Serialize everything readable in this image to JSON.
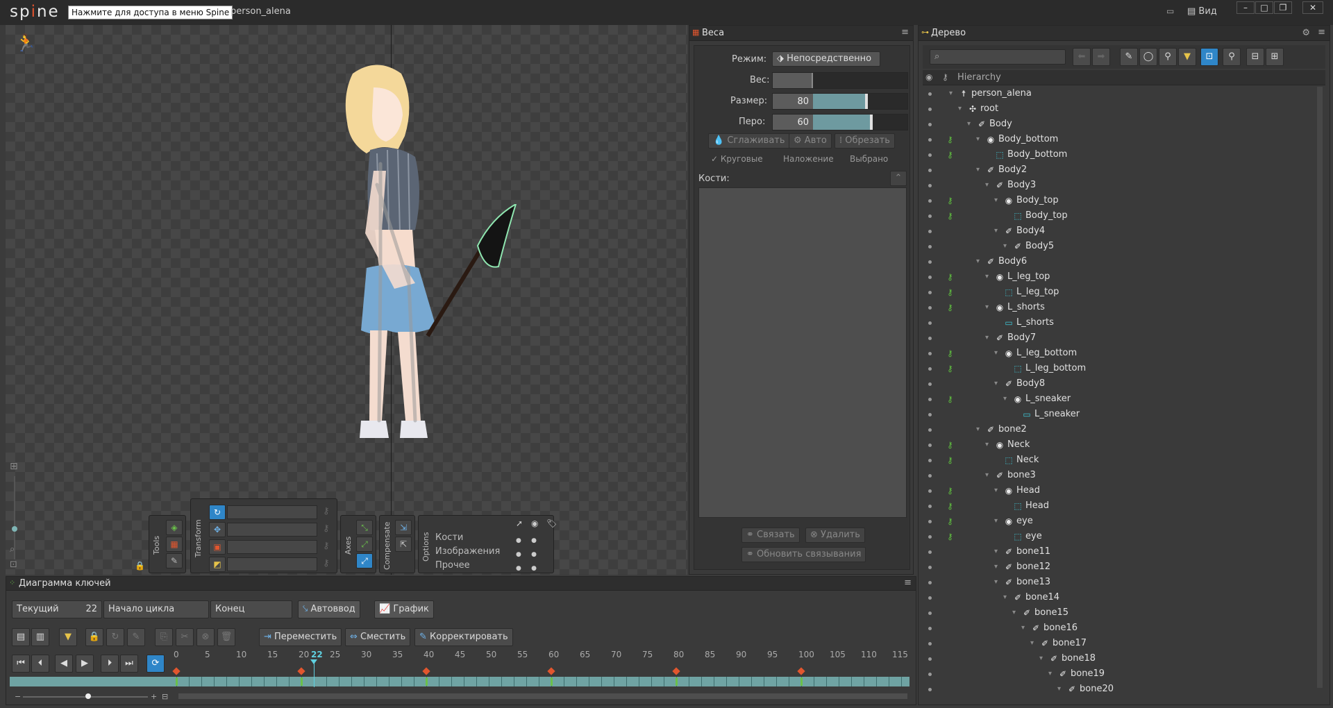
{
  "titlebar": {
    "logo": "spine",
    "tooltip": "Нажмите для доступа в меню Spine",
    "filename": "person_alena",
    "view_menu": "Вид"
  },
  "tools": {
    "tools_label": "Tools",
    "transform_label": "Transform",
    "axes_label": "Axes",
    "compensate_label": "Compensate",
    "options_label": "Options",
    "options_rows": [
      "Кости",
      "Изображения",
      "Прочее"
    ]
  },
  "weights": {
    "title": "Веса",
    "mode_label": "Режим:",
    "mode_value": "Непосредственно",
    "weight_label": "Вес:",
    "size_label": "Размер:",
    "size_value": "80",
    "size_fraction": 0.4,
    "feather_label": "Перо:",
    "feather_value": "60",
    "feather_fraction": 0.45,
    "smooth_btn": "Сглаживать",
    "auto_btn": "Авто",
    "prune_btn": "Обрезать",
    "circular_chk": "Круговые",
    "overlay_chk": "Наложение",
    "selected_chk": "Выбрано",
    "bones_label": "Кости:",
    "bind_btn": "Связать",
    "delete_btn": "Удалить",
    "update_btn": "Обновить связывания"
  },
  "tree": {
    "title": "Дерево",
    "hierarchy_label": "Hierarchy",
    "rows": [
      {
        "name": "person_alena",
        "depth": 0,
        "icon": "skeleton-icon",
        "key": false
      },
      {
        "name": "root",
        "depth": 1,
        "icon": "root-icon",
        "key": false
      },
      {
        "name": "Body",
        "depth": 2,
        "icon": "bone-icon",
        "key": false
      },
      {
        "name": "Body_bottom",
        "depth": 3,
        "icon": "slot-icon",
        "key": true
      },
      {
        "name": "Body_bottom",
        "depth": 4,
        "icon": "mesh-icon",
        "key": true
      },
      {
        "name": "Body2",
        "depth": 3,
        "icon": "bone-icon",
        "key": false
      },
      {
        "name": "Body3",
        "depth": 4,
        "icon": "bone-icon",
        "key": false
      },
      {
        "name": "Body_top",
        "depth": 5,
        "icon": "slot-icon",
        "key": true
      },
      {
        "name": "Body_top",
        "depth": 6,
        "icon": "mesh-icon",
        "key": true
      },
      {
        "name": "Body4",
        "depth": 5,
        "icon": "bone-icon",
        "key": false
      },
      {
        "name": "Body5",
        "depth": 6,
        "icon": "bone-icon",
        "key": false
      },
      {
        "name": "Body6",
        "depth": 3,
        "icon": "bone-icon",
        "key": false
      },
      {
        "name": "L_leg_top",
        "depth": 4,
        "icon": "slot-icon",
        "key": true
      },
      {
        "name": "L_leg_top",
        "depth": 5,
        "icon": "mesh-icon",
        "key": true
      },
      {
        "name": "L_shorts",
        "depth": 4,
        "icon": "slot-icon",
        "key": true
      },
      {
        "name": "L_shorts",
        "depth": 5,
        "icon": "region-icon",
        "key": false
      },
      {
        "name": "Body7",
        "depth": 4,
        "icon": "bone-icon",
        "key": false
      },
      {
        "name": "L_leg_bottom",
        "depth": 5,
        "icon": "slot-icon",
        "key": true
      },
      {
        "name": "L_leg_bottom",
        "depth": 6,
        "icon": "mesh-icon",
        "key": true
      },
      {
        "name": "Body8",
        "depth": 5,
        "icon": "bone-icon",
        "key": false
      },
      {
        "name": "L_sneaker",
        "depth": 6,
        "icon": "slot-icon",
        "key": true
      },
      {
        "name": "L_sneaker",
        "depth": 7,
        "icon": "region-icon",
        "key": false
      },
      {
        "name": "bone2",
        "depth": 3,
        "icon": "bone-icon",
        "key": false
      },
      {
        "name": "Neck",
        "depth": 4,
        "icon": "slot-icon",
        "key": true
      },
      {
        "name": "Neck",
        "depth": 5,
        "icon": "mesh-icon",
        "key": true
      },
      {
        "name": "bone3",
        "depth": 4,
        "icon": "bone-icon",
        "key": false
      },
      {
        "name": "Head",
        "depth": 5,
        "icon": "slot-icon",
        "key": true
      },
      {
        "name": "Head",
        "depth": 6,
        "icon": "mesh-icon",
        "key": true
      },
      {
        "name": "eye",
        "depth": 5,
        "icon": "slot-icon",
        "key": true
      },
      {
        "name": "eye",
        "depth": 6,
        "icon": "mesh-icon",
        "key": true
      },
      {
        "name": "bone11",
        "depth": 5,
        "icon": "bone-icon",
        "key": false
      },
      {
        "name": "bone12",
        "depth": 5,
        "icon": "bone-icon",
        "key": false
      },
      {
        "name": "bone13",
        "depth": 5,
        "icon": "bone-icon",
        "key": false
      },
      {
        "name": "bone14",
        "depth": 6,
        "icon": "bone-icon",
        "key": false
      },
      {
        "name": "bone15",
        "depth": 7,
        "icon": "bone-icon",
        "key": false
      },
      {
        "name": "bone16",
        "depth": 8,
        "icon": "bone-icon",
        "key": false
      },
      {
        "name": "bone17",
        "depth": 9,
        "icon": "bone-icon",
        "key": false
      },
      {
        "name": "bone18",
        "depth": 10,
        "icon": "bone-icon",
        "key": false
      },
      {
        "name": "bone19",
        "depth": 11,
        "icon": "bone-icon",
        "key": false
      },
      {
        "name": "bone20",
        "depth": 12,
        "icon": "bone-icon",
        "key": false
      }
    ]
  },
  "dopesheet": {
    "title": "Диаграмма ключей",
    "current_label": "Текущий",
    "current_value": "22",
    "loop_start_label": "Начало цикла",
    "end_label": "Конец",
    "autokey_btn": "Автоввод",
    "graph_btn": "График",
    "move_btn": "Переместить",
    "offset_btn": "Сместить",
    "adjust_btn": "Корректировать",
    "track_name": "run",
    "ruler": [
      "0",
      "5",
      "10",
      "15",
      "20",
      "22",
      "25",
      "30",
      "35",
      "40",
      "45",
      "50",
      "55",
      "60",
      "65",
      "70",
      "75",
      "80",
      "85",
      "90",
      "95",
      "100",
      "105",
      "110",
      "115"
    ],
    "current_frame": 22,
    "keyframes": [
      0,
      20,
      40,
      60,
      80,
      100
    ],
    "colors": {
      "accent": "#2f86c8",
      "track": "#6fa3a3",
      "key": "#e2562e",
      "keygreen": "#6ac04a"
    }
  }
}
